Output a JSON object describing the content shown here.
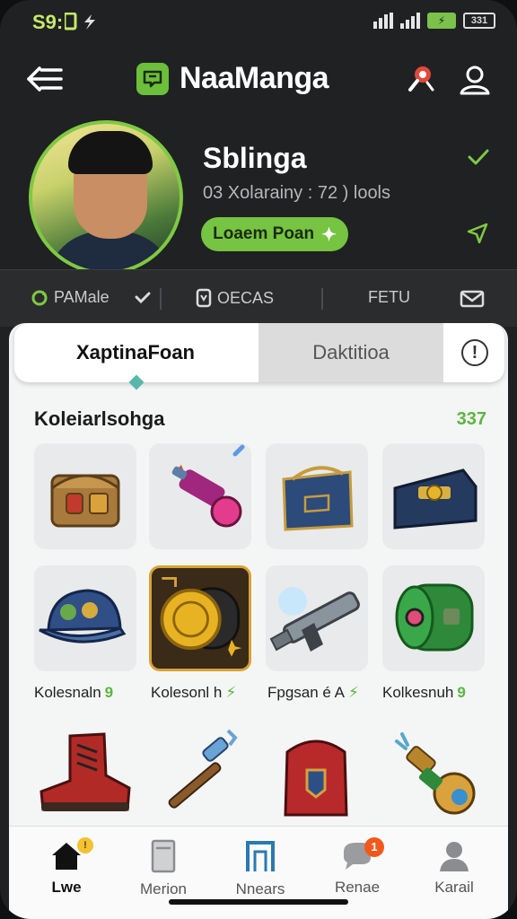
{
  "status": {
    "time": "S9:",
    "battery": "331"
  },
  "header": {
    "app_title": "NaaManga"
  },
  "profile": {
    "name": "Sblinga",
    "stats": "03 Xolarainy : 72 ) lools",
    "button_label": "Loaem Poan"
  },
  "meta_row": {
    "items": [
      "PAMale",
      "OECAS",
      "FETU"
    ]
  },
  "tabs": {
    "active": "XaptinaFoan",
    "inactive": "Daktitioa",
    "info": "!"
  },
  "collection": {
    "title": "Koleiarlsohga",
    "count": "337",
    "row2_labels": [
      "Kolesnaln",
      "Kolesonl h",
      "Fpgsan é A",
      "Kolkesnuh"
    ],
    "row2_marks": [
      "9",
      "⚡",
      "⚡",
      "9"
    ]
  },
  "bottom_nav": {
    "items": [
      "Lwe",
      "Merion",
      "Nnears",
      "Renae",
      "Karail"
    ],
    "badges": {
      "home": "!",
      "renae": "1"
    }
  },
  "colors": {
    "accent": "#76c442",
    "dark": "#1f2123",
    "badge_yellow": "#f2c230",
    "badge_orange": "#f1591c"
  }
}
